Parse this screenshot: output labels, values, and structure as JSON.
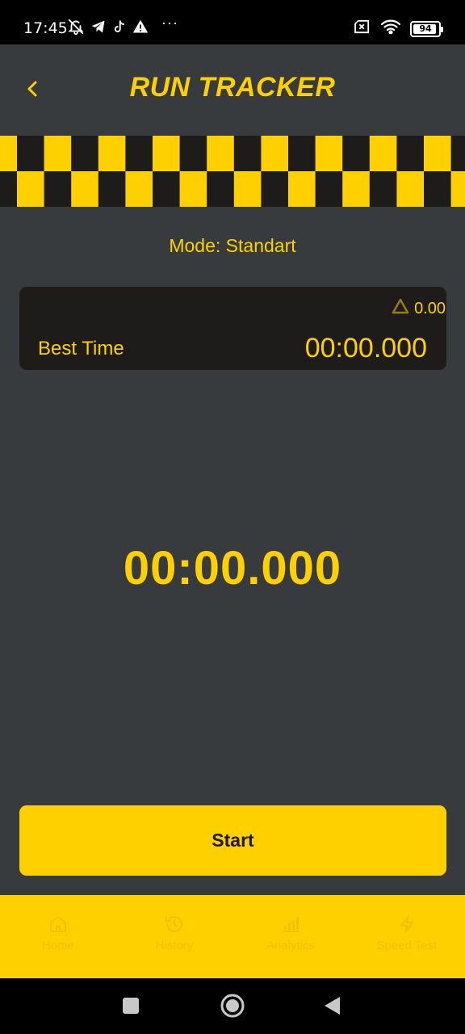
{
  "status_bar": {
    "time": "17:45",
    "overflow": "···",
    "battery_level": "94"
  },
  "header": {
    "title": "RUN TRACKER"
  },
  "mode": {
    "text": "Mode: Standart"
  },
  "best": {
    "delta": "0.00",
    "label": "Best Time",
    "value": "00:00.000"
  },
  "timer": {
    "value": "00:00.000"
  },
  "start": {
    "label": "Start"
  },
  "nav": {
    "items": [
      {
        "label": "Home",
        "icon": "home-icon"
      },
      {
        "label": "History",
        "icon": "history-icon"
      },
      {
        "label": "Analytics",
        "icon": "analytics-icon"
      },
      {
        "label": "Speed Test",
        "icon": "lightning-icon"
      }
    ]
  },
  "colors": {
    "accent": "#fed000",
    "background": "#383b3e",
    "card": "#1e1c1b",
    "checker_dark": "#1e1c1b"
  }
}
